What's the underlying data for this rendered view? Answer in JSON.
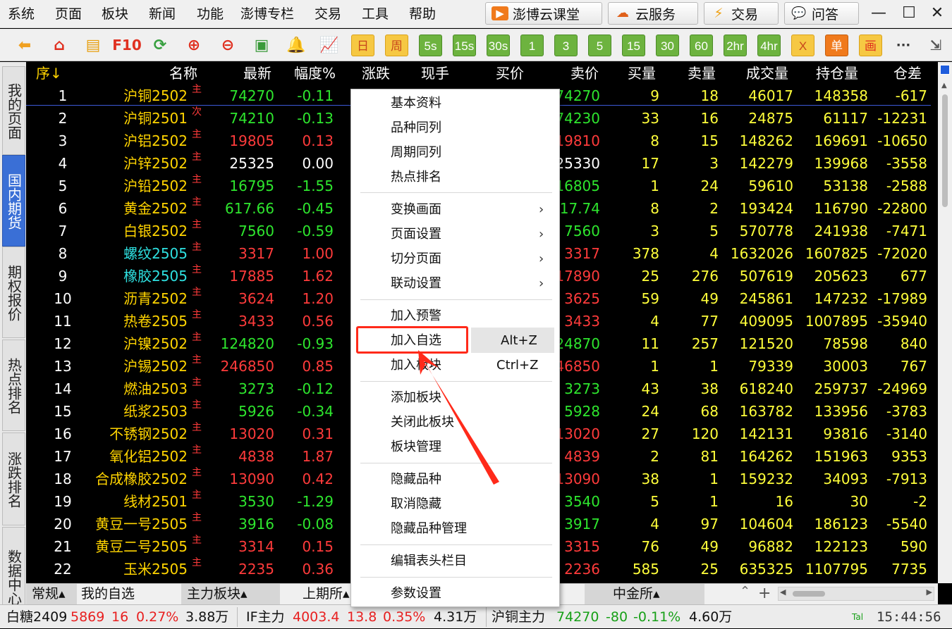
{
  "menu": [
    "系统",
    "页面",
    "板块",
    "新闻",
    "功能",
    "澎博专栏",
    "交易",
    "工具",
    "帮助"
  ],
  "top_buttons": [
    {
      "label": "澎博云课堂",
      "icon": "video-icon"
    },
    {
      "label": "云服务",
      "icon": "cloud-icon"
    },
    {
      "label": "交易",
      "icon": "lightning-icon"
    },
    {
      "label": "问答",
      "icon": "chat-icon"
    }
  ],
  "toolbar": {
    "f10": "F10",
    "periods": [
      "日",
      "周",
      "5s",
      "15s",
      "30s",
      "1",
      "3",
      "5",
      "15",
      "30",
      "60",
      "2hr",
      "4hr"
    ],
    "x": "X",
    "single": "单",
    "draw": "画",
    "more": "···"
  },
  "left_nav": [
    "我的页面",
    "国内期货",
    "期权报价",
    "热点排名",
    "涨跌排名",
    "数据中心"
  ],
  "columns": [
    "序↓",
    "名称",
    "最新",
    "幅度%",
    "涨跌",
    "现手",
    "买价",
    "卖价",
    "买量",
    "卖量",
    "成交量",
    "持仓量",
    "仓差"
  ],
  "rows": [
    {
      "i": "1",
      "n": "沪铜2502",
      "m": "主",
      "p": "74270",
      "r": "-0.11",
      "s": "74270",
      "bv": "9",
      "sv": "18",
      "vol": "46017",
      "oi": "148358",
      "d": "-617",
      "col": "g"
    },
    {
      "i": "2",
      "n": "沪铜2501",
      "m": "次",
      "p": "74210",
      "r": "-0.13",
      "s": "74230",
      "bv": "33",
      "sv": "16",
      "vol": "24875",
      "oi": "61117",
      "d": "-12231",
      "col": "g"
    },
    {
      "i": "3",
      "n": "沪铝2502",
      "m": "主",
      "p": "19805",
      "r": "0.13",
      "s": "19810",
      "bv": "8",
      "sv": "15",
      "vol": "148262",
      "oi": "169691",
      "d": "-10650",
      "col": "r"
    },
    {
      "i": "4",
      "n": "沪锌2502",
      "m": "主",
      "p": "25325",
      "r": "0.00",
      "s": "25330",
      "bv": "17",
      "sv": "3",
      "vol": "142279",
      "oi": "139968",
      "d": "-3558",
      "col": "w"
    },
    {
      "i": "5",
      "n": "沪铅2502",
      "m": "主",
      "p": "16795",
      "r": "-1.55",
      "s": "16805",
      "bv": "1",
      "sv": "24",
      "vol": "59610",
      "oi": "53138",
      "d": "-2588",
      "col": "g"
    },
    {
      "i": "6",
      "n": "黄金2502",
      "m": "主",
      "p": "617.66",
      "r": "-0.45",
      "s": "617.74",
      "bv": "8",
      "sv": "2",
      "vol": "193424",
      "oi": "116790",
      "d": "-22800",
      "col": "g"
    },
    {
      "i": "7",
      "n": "白银2502",
      "m": "主",
      "p": "7560",
      "r": "-0.59",
      "s": "7560",
      "bv": "3",
      "sv": "5",
      "vol": "570778",
      "oi": "241938",
      "d": "-7471",
      "col": "g"
    },
    {
      "i": "8",
      "n": "螺纹2505",
      "m": "主",
      "p": "3317",
      "r": "1.00",
      "s": "3317",
      "bv": "378",
      "sv": "4",
      "vol": "1632026",
      "oi": "1607825",
      "d": "-72020",
      "col": "r",
      "cyan": true
    },
    {
      "i": "9",
      "n": "橡胶2505",
      "m": "主",
      "p": "17885",
      "r": "1.62",
      "s": "17890",
      "bv": "25",
      "sv": "276",
      "vol": "507619",
      "oi": "205623",
      "d": "677",
      "col": "r",
      "cyan": true
    },
    {
      "i": "10",
      "n": "沥青2502",
      "m": "主",
      "p": "3624",
      "r": "1.20",
      "s": "3625",
      "bv": "59",
      "sv": "49",
      "vol": "245861",
      "oi": "147232",
      "d": "-17989",
      "col": "r"
    },
    {
      "i": "11",
      "n": "热卷2505",
      "m": "主",
      "p": "3433",
      "r": "0.56",
      "s": "3433",
      "bv": "4",
      "sv": "77",
      "vol": "409095",
      "oi": "1007895",
      "d": "-35940",
      "col": "r"
    },
    {
      "i": "12",
      "n": "沪镍2502",
      "m": "主",
      "p": "124820",
      "r": "-0.93",
      "s": "124870",
      "bv": "11",
      "sv": "257",
      "vol": "121520",
      "oi": "78598",
      "d": "840",
      "col": "g"
    },
    {
      "i": "13",
      "n": "沪锡2502",
      "m": "主",
      "p": "246850",
      "r": "0.85",
      "s": "246850",
      "bv": "1",
      "sv": "1",
      "vol": "79339",
      "oi": "30003",
      "d": "767",
      "col": "r"
    },
    {
      "i": "14",
      "n": "燃油2503",
      "m": "主",
      "p": "3273",
      "r": "-0.12",
      "s": "3273",
      "bv": "43",
      "sv": "38",
      "vol": "618240",
      "oi": "259737",
      "d": "-24969",
      "col": "g"
    },
    {
      "i": "15",
      "n": "纸浆2503",
      "m": "主",
      "p": "5926",
      "r": "-0.34",
      "s": "5928",
      "bv": "24",
      "sv": "68",
      "vol": "163782",
      "oi": "133956",
      "d": "-3783",
      "col": "g"
    },
    {
      "i": "16",
      "n": "不锈钢2502",
      "m": "主",
      "p": "13020",
      "r": "0.31",
      "s": "13020",
      "bv": "27",
      "sv": "120",
      "vol": "142131",
      "oi": "93816",
      "d": "-3140",
      "col": "r"
    },
    {
      "i": "17",
      "n": "氧化铝2502",
      "m": "主",
      "p": "4838",
      "r": "1.87",
      "s": "4839",
      "bv": "2",
      "sv": "81",
      "vol": "164262",
      "oi": "151963",
      "d": "9353",
      "col": "r"
    },
    {
      "i": "18",
      "n": "合成橡胶2502",
      "m": "主",
      "p": "13090",
      "r": "0.42",
      "s": "13090",
      "bv": "38",
      "sv": "1",
      "vol": "159232",
      "oi": "34093",
      "d": "-7913",
      "col": "r"
    },
    {
      "i": "19",
      "n": "线材2501",
      "m": "主",
      "p": "3530",
      "r": "-1.29",
      "s": "3540",
      "bv": "5",
      "sv": "1",
      "vol": "16",
      "oi": "30",
      "d": "-2",
      "col": "g"
    },
    {
      "i": "20",
      "n": "黄豆一号2505",
      "m": "主",
      "p": "3916",
      "r": "-0.08",
      "s": "3917",
      "bv": "4",
      "sv": "97",
      "vol": "104604",
      "oi": "186123",
      "d": "-5540",
      "col": "g"
    },
    {
      "i": "21",
      "n": "黄豆二号2505",
      "m": "主",
      "p": "3314",
      "r": "0.15",
      "s": "3315",
      "bv": "76",
      "sv": "49",
      "vol": "96882",
      "oi": "122123",
      "d": "590",
      "col": "r"
    },
    {
      "i": "22",
      "n": "玉米2505",
      "m": "主",
      "p": "2235",
      "r": "0.36",
      "s": "2236",
      "bv": "585",
      "sv": "25",
      "vol": "635325",
      "oi": "1107795",
      "d": "7735",
      "col": "r"
    }
  ],
  "bottom_tabs": [
    "常规▴",
    "我的自选",
    "主力板块▴",
    "上期所▴",
    "中金所▴"
  ],
  "tab_controls": {
    "collapse": "⌃",
    "add": "+"
  },
  "status": {
    "t1": {
      "name": "白糖2409",
      "price": "5869",
      "chg": "16",
      "pct": "0.27%",
      "vol": "3.88万"
    },
    "t2": {
      "name": "IF主力",
      "price": "4003.4",
      "chg": "13.8",
      "pct": "0.35%",
      "vol": "4.31万"
    },
    "t3": {
      "name": "沪铜主力",
      "price": "74270",
      "chg": "-80",
      "pct": "-0.11%",
      "vol": "4.60万"
    },
    "signal": "Tal",
    "time": "15:44:56"
  },
  "context_menu": {
    "g1": [
      "基本资料",
      "品种同列",
      "周期同列",
      "热点排名"
    ],
    "g2": [
      "变换画面",
      "页面设置",
      "切分页面",
      "联动设置"
    ],
    "g3": [
      "加入预警",
      "加入自选",
      "加入板块"
    ],
    "shortcuts": {
      "add_favorite": "Alt+Z",
      "add_block": "Ctrl+Z"
    },
    "g4": [
      "添加板块",
      "关闭此板块",
      "板块管理"
    ],
    "g5": [
      "隐藏品种",
      "取消隐藏",
      "隐藏品种管理"
    ],
    "g6": [
      "编辑表头栏目"
    ],
    "g7": [
      "参数设置"
    ],
    "submenu_arrow": "›"
  },
  "colors": {
    "up": "#ff3b3b",
    "down": "#2ee62e",
    "flat": "#ffffff",
    "name": "#ffd400",
    "cyan_name": "#2ee0e0",
    "num": "#ffff3a",
    "highlight": "#ff2a1a"
  }
}
